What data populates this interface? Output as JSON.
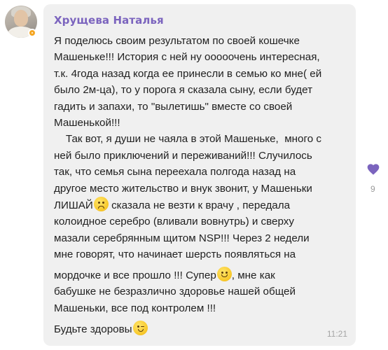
{
  "message": {
    "sender": "Хрущева Наталья",
    "lines": [
      "Я поделюсь своим результатом по своей кошечке",
      "Машеньке!!! История с ней ну ооооочень интересная,",
      "т.к. 4года назад когда ее принесли в семью ко мне( ей",
      "было 2м-ца), то у порога я сказала сыну, если будет",
      "гадить и запахи,  то \"вылетишь\" вместе со своей",
      "Машенькой!!!",
      "    Так вот, я души не чаяла в этой Машеньке,  много с",
      "ней было приключений и переживаний!!! Случилось",
      "так,  что семья сына переехала полгода назад  на",
      "другое место жительство и внук звонит, у Машеньки"
    ],
    "line_11_part1": "ЛИШАЙ",
    "line_11_part2": " сказала не везти к врачу ,  передала",
    "lines_b": [
      "колоидное серебро (вливали вовнутрь) и сверху",
      "мазали серебрянным щитом NSP!!!  Через 2 недели",
      "мне говорят,  что начинает шерсть появляться на"
    ],
    "line_15_part1": "мордочке и все прошло !!! Супер",
    "line_15_part2": ",  мне как",
    "lines_c": [
      "бабушке не безразлично здоровье нашей общей",
      "Машеньки,  все под контролем !!!"
    ],
    "closing": "Будьте здоровы",
    "time": "11:21"
  },
  "reactions": {
    "like_icon": "heart-icon",
    "like_count": "9",
    "accent_color": "#7b64be"
  }
}
